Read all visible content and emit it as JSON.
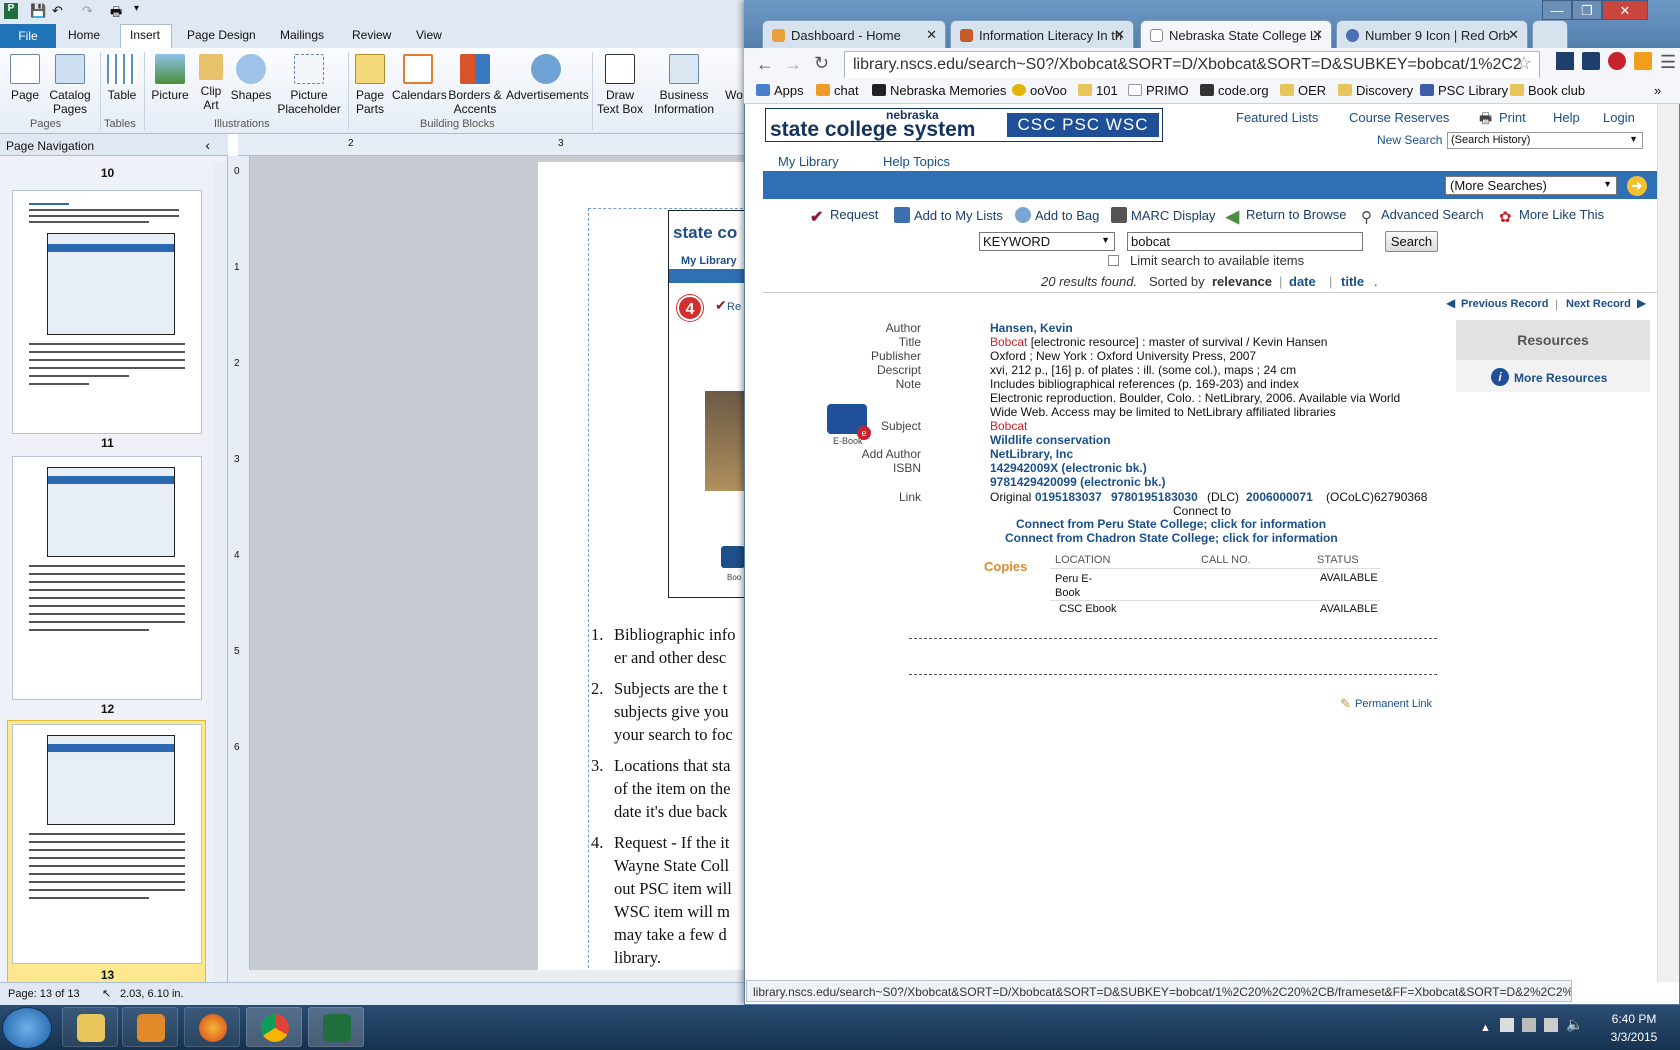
{
  "publisher": {
    "file_tab": "File",
    "ribbon_tabs": [
      "Home",
      "Insert",
      "Page Design",
      "Mailings",
      "Review",
      "View"
    ],
    "buttons": {
      "page": "Page",
      "catalog_pages": "Catalog\nPages",
      "table": "Table",
      "picture": "Picture",
      "clip_art": "Clip\nArt",
      "shapes": "Shapes",
      "picture_placeholder": "Picture\nPlaceholder",
      "page_parts": "Page\nParts",
      "calendars": "Calendars",
      "borders_accents": "Borders &\nAccents",
      "advertisements": "Advertisements",
      "draw_text_box": "Draw\nText Box",
      "business_information": "Business\nInformation",
      "wo": "Wo"
    },
    "groups": [
      "Pages",
      "Tables",
      "Illustrations",
      "Building Blocks"
    ],
    "nav_pane_title": "Page Navigation",
    "nav_pane_close": "‹",
    "page_numbers": [
      "10",
      "11",
      "12",
      "13"
    ],
    "status_page": "Page: 13 of 13",
    "status_position": "2.03, 6.10 in.",
    "ruler_h": [
      "2",
      "3"
    ],
    "ruler_v": [
      "0",
      "1",
      "2",
      "3",
      "4",
      "5",
      "6"
    ],
    "doc_lines": [
      "Bibliographic info",
      "er and other desc",
      "Subjects are the t",
      "subjects give you",
      "your search to foc",
      "Locations that sta",
      "of the item on the",
      "date it's due back",
      "Request - If the it",
      "Wayne State Coll",
      "out PSC item will",
      "WSC item will m",
      "may take a few d",
      "library."
    ],
    "doc_list_numbers": [
      "1.",
      "2.",
      "3.",
      "4."
    ],
    "doc_shot": {
      "brand": "state co",
      "my_library": "My Library",
      "step": "4",
      "req": "Re",
      "ebook": "Boo"
    }
  },
  "browser": {
    "tabs": [
      {
        "title": "Dashboard - Home",
        "color": "#e8a13a"
      },
      {
        "title": "Information Literacy In th",
        "color": "#c85a2a"
      },
      {
        "title": "Nebraska State College Li",
        "color": "#ffffff"
      },
      {
        "title": "Number 9 Icon | Red Orb",
        "color": "#4a6fb5"
      }
    ],
    "url": "library.nscs.edu/search~S0?/Xbobcat&SORT=D/Xbobcat&SORT=D&SUBKEY=bobcat/1%2C2",
    "bookmarks": [
      "Apps",
      "chat",
      "Nebraska Memories",
      "ooVoo",
      "101",
      "PRIMO",
      "code.org",
      "OER",
      "Discovery",
      "PSC Library",
      "Book club"
    ],
    "status_url": "library.nscs.edu/search~S0?/Xbobcat&SORT=D/Xbobcat&SORT=D&SUBKEY=bobcat/1%2C20%2C20%2CB/frameset&FF=Xbobcat&SORT=D&2%2C2%2C"
  },
  "catalog": {
    "logo_top": "nebraska",
    "logo_main": "state college system",
    "logo_campuses": "CSC PSC WSC",
    "top_links": [
      "Featured Lists",
      "Course Reserves",
      "Print",
      "Help",
      "Login"
    ],
    "new_search": "New Search",
    "search_history": "(Search History)",
    "my_library": "My Library",
    "help_topics": "Help Topics",
    "more_searches": "(More Searches)",
    "actions": [
      "Request",
      "Add to My Lists",
      "Add to Bag",
      "MARC Display",
      "Return to Browse",
      "Advanced Search",
      "More Like This"
    ],
    "search_type": "KEYWORD",
    "search_value": "bobcat",
    "search_button": "Search",
    "limit_label": "Limit search to available items",
    "results_text": "20 results found.",
    "sorted_by": "Sorted by",
    "sort_relevance": "relevance",
    "sort_date": "date",
    "sort_title": "title",
    "prev_record": "Previous Record",
    "next_record": "Next Record",
    "ebook_label": "E-Book",
    "resources_title": "Resources",
    "more_resources": "More Resources",
    "record": {
      "author_label": "Author",
      "author": "Hansen, Kevin",
      "title_label": "Title",
      "title_link": "Bobcat",
      "title_rest": " [electronic resource] : master of survival / Kevin Hansen",
      "publisher_label": "Publisher",
      "publisher": "Oxford ; New York : Oxford University Press, 2007",
      "descript_label": "Descript",
      "descript": "xvi, 212 p., [16] p. of plates : ill. (some col.), maps ; 24 cm",
      "note_label": "Note",
      "note1": "Includes bibliographical references (p. 169-203) and index",
      "note2": "Electronic reproduction. Boulder, Colo. : NetLibrary, 2006. Available via World",
      "note3": "Wide Web. Access may be limited to NetLibrary affiliated libraries",
      "subject_label": "Subject",
      "subject1": "Bobcat",
      "subject2": "Wildlife conservation",
      "add_author_label": "Add Author",
      "add_author": "NetLibrary, Inc",
      "isbn_label": "ISBN",
      "isbn1": "142942009X (electronic bk.)",
      "isbn2": "9781429420099 (electronic bk.)",
      "link_label": "Link",
      "link_original": "Original",
      "link_isbn10": "0195183037",
      "link_isbn13": "9780195183030",
      "link_dlc": "(DLC)",
      "link_lccn": "2006000071",
      "link_oclc": "(OCoLC)62790368"
    },
    "connect_to": "Connect to",
    "connect_peru": "Connect from Peru State College; click for information",
    "connect_chadron": "Connect from Chadron State College; click for information",
    "copies_label": "Copies",
    "copies_headers": [
      "LOCATION",
      "CALL NO.",
      "STATUS"
    ],
    "copies_rows": [
      {
        "location": "Peru E-\nBook",
        "call_no": "",
        "status": "AVAILABLE"
      },
      {
        "location": "CSC Ebook",
        "call_no": "",
        "status": "AVAILABLE"
      }
    ],
    "permanent_link": "Permanent Link"
  },
  "taskbar": {
    "clock_time": "6:40 PM",
    "clock_date": "3/3/2015"
  }
}
